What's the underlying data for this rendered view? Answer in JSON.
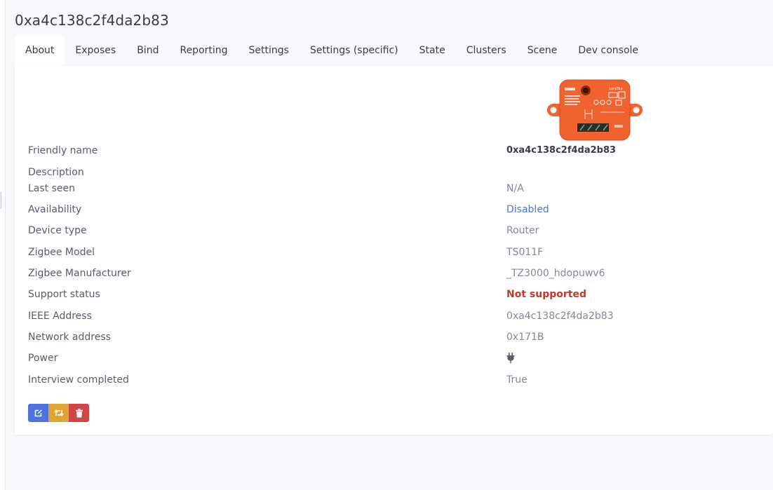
{
  "device": {
    "title": "0xa4c138c2f4da2b83"
  },
  "tabs": [
    {
      "label": "About",
      "active": true
    },
    {
      "label": "Exposes"
    },
    {
      "label": "Bind"
    },
    {
      "label": "Reporting"
    },
    {
      "label": "Settings"
    },
    {
      "label": "Settings (specific)"
    },
    {
      "label": "State"
    },
    {
      "label": "Clusters"
    },
    {
      "label": "Scene"
    },
    {
      "label": "Dev console"
    }
  ],
  "about": {
    "rows": [
      {
        "label": "Friendly name",
        "value": "0xa4c138c2f4da2b83"
      },
      {
        "label": "Description",
        "value": ""
      },
      {
        "label": "Last seen",
        "value": "N/A"
      },
      {
        "label": "Availability",
        "value": "Disabled"
      },
      {
        "label": "Device type",
        "value": "Router"
      },
      {
        "label": "Zigbee Model",
        "value": "TS011F"
      },
      {
        "label": "Zigbee Manufacturer",
        "value": "_TZ3000_hdopuwv6"
      },
      {
        "label": "Support status",
        "value": "Not supported"
      },
      {
        "label": "IEEE Address",
        "value": "0xa4c138c2f4da2b83"
      },
      {
        "label": "Network address",
        "value": "0x171B"
      },
      {
        "label": "Power",
        "icon": "plug-icon"
      },
      {
        "label": "Interview completed",
        "value": "True"
      }
    ],
    "image_label": "LoraTap"
  },
  "actions": {
    "edit_icon": "edit-icon",
    "rename_icon": "retweet-icon",
    "remove_icon": "trash-icon"
  },
  "colors": {
    "primary": "#4e73df",
    "warning": "#e0a434",
    "danger": "#d14545",
    "device_orange": "#f0622e",
    "not_supported": "#c0392b"
  }
}
